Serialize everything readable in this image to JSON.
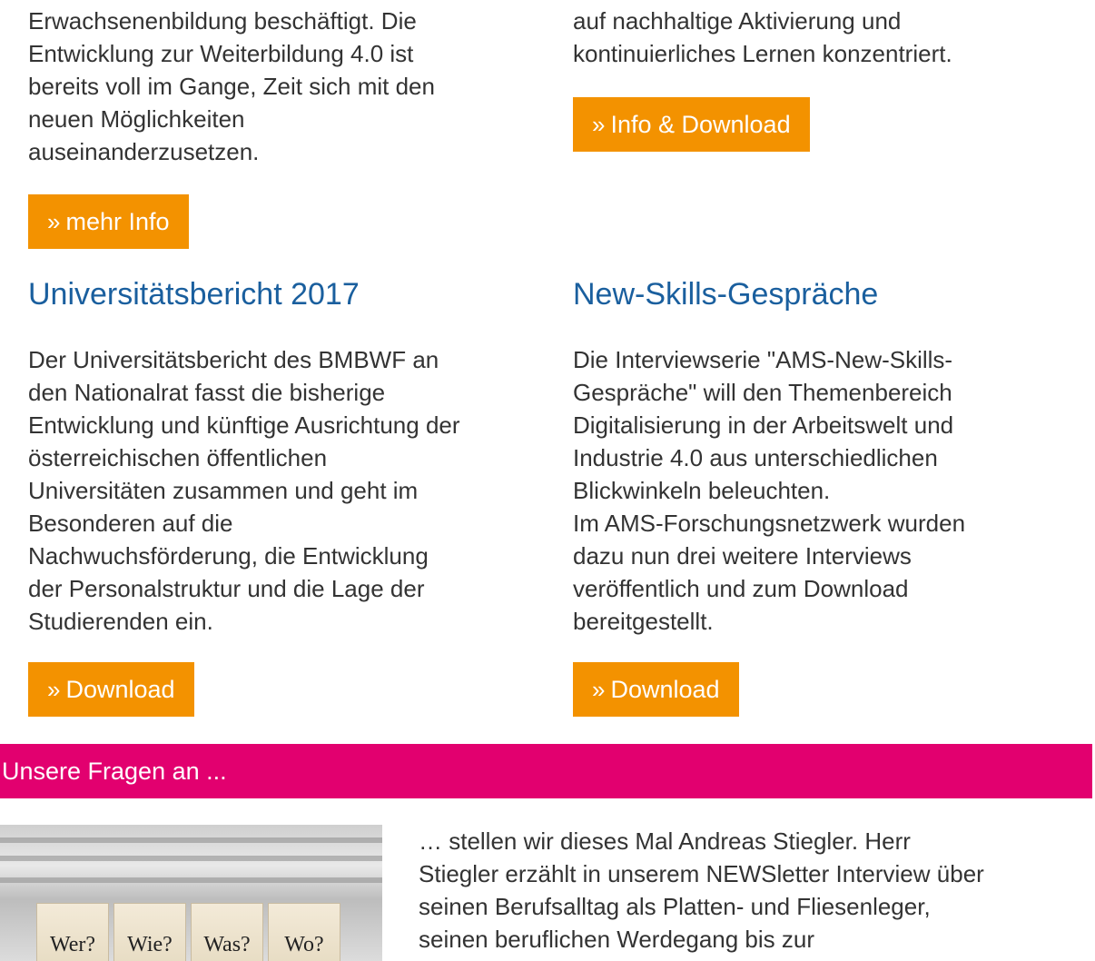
{
  "left_top": {
    "text_lines": "Erwachsenenbildung beschäftigt. Die\nEntwicklung zur Weiterbildung 4.0 ist\nbereits voll im Gange, Zeit sich mit den\nneuen Möglichkeiten\nauseinanderzusetzen.",
    "button_label": "mehr Info"
  },
  "right_top": {
    "text_lines": "auf nachhaltige Aktivierung und\nkontinuierliches Lernen konzentriert.",
    "button_label": "Info & Download"
  },
  "universitaetsbericht": {
    "title": "Universitätsbericht 2017",
    "text": "Der Universitätsbericht des BMBWF an\nden Nationalrat fasst die bisherige\nEntwicklung und künftige Ausrichtung der\nösterreichischen öffentlichen\nUniversitäten zusammen und geht im\nBesonderen auf die\nNachwuchsförderung, die Entwicklung\nder Personalstruktur und die Lage der\nStudierenden ein.",
    "button_label": "Download"
  },
  "new_skills": {
    "title": "New-Skills-Gespräche",
    "text": "Die Interviewserie \"AMS-New-Skills-\nGespräche\" will den Themenbereich\nDigitalisierung in der Arbeitswelt und\nIndustrie 4.0 aus unterschiedlichen\nBlickwinkeln beleuchten.\nIm AMS-Forschungsnetzwerk wurden\ndazu nun drei weitere Interviews\nveröffentlich und zum Download\nbereitgestellt.",
    "button_label": "Download"
  },
  "interview": {
    "bar_title": "Unsere Fragen an ...",
    "image_words": [
      "Wer?",
      "Wie?",
      "Was?",
      "Wo?"
    ],
    "text": "… stellen wir dieses Mal Andreas Stiegler. Herr\nStiegler erzählt in unserem NEWSletter Interview über\nseinen Berufsalltag als Platten- und Fliesenleger,\nseinen beruflichen Werdegang bis zur"
  },
  "colors": {
    "button_orange": "#f39200",
    "title_blue": "#1a5f9e",
    "bar_pink": "#e2006f"
  },
  "icons": {
    "button_chevron": "»"
  }
}
